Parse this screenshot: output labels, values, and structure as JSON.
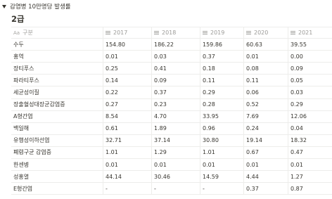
{
  "toggle": {
    "label": "감염병 10만명당 발생률"
  },
  "heading": "2급",
  "table": {
    "name_icon": "Aa",
    "columns": [
      "구분",
      "2017",
      "2018",
      "2019",
      "2020",
      "2021"
    ],
    "rows": [
      [
        "수두",
        "154.80",
        "186.22",
        "159.86",
        "60.63",
        "39.55"
      ],
      [
        "홍역",
        "0.01",
        "0.03",
        "0.37",
        "0.01",
        "0.00"
      ],
      [
        "장티푸스",
        "0.25",
        "0.41",
        "0.18",
        "0.08",
        "0.09"
      ],
      [
        "파라티푸스",
        "0.14",
        "0.09",
        "0.11",
        "0.11",
        "0.05"
      ],
      [
        "세균성이질",
        "0.22",
        "0.37",
        "0.29",
        "0.06",
        "0.03"
      ],
      [
        "장출혈성대장균감염증",
        "0.27",
        "0.23",
        "0.28",
        "0.52",
        "0.29"
      ],
      [
        "A형간염",
        "8.54",
        "4.70",
        "33.95",
        "7.69",
        "12.06"
      ],
      [
        "백일해",
        "0.61",
        "1.89",
        "0.96",
        "0.24",
        "0.04"
      ],
      [
        "유행성이하선염",
        "32.71",
        "37.14",
        "30.80",
        "19.14",
        "18.32"
      ],
      [
        "폐렴구균 감염증",
        "1.01",
        "1.29",
        "1.01",
        "0.67",
        "0.47"
      ],
      [
        "한센병",
        "0.01",
        "0.01",
        "0.01",
        "0.01",
        "0.01"
      ],
      [
        "성홍열",
        "44.14",
        "30.46",
        "14.59",
        "4.44",
        "1.27"
      ],
      [
        "E형간염",
        "-",
        "-",
        "-",
        "0.37",
        "0.87"
      ]
    ]
  }
}
